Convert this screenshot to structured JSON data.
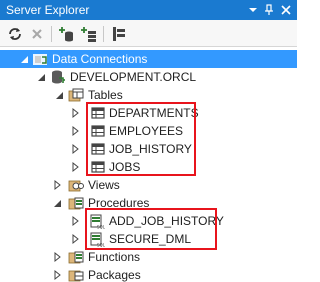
{
  "panel": {
    "title": "Server Explorer",
    "pin_glyph": "⊣",
    "close_glyph": "✕"
  },
  "toolbar": {
    "tools": [
      "refresh-icon",
      "stop-icon",
      "connect-to-database-icon",
      "connect-to-server-icon",
      "properties-icon"
    ]
  },
  "tree": {
    "data_connections": "Data Connections",
    "connection": "DEVELOPMENT.ORCL",
    "tables": "Tables",
    "table_items": [
      "DEPARTMENTS",
      "EMPLOYEES",
      "JOB_HISTORY",
      "JOBS"
    ],
    "views": "Views",
    "procedures": "Procedures",
    "procedure_items": [
      "ADD_JOB_HISTORY",
      "SECURE_DML"
    ],
    "functions": "Functions",
    "packages": "Packages"
  },
  "colors": {
    "title_bar": "#1a7ad0",
    "selection": "#3399ff",
    "highlight": "#e8141c"
  }
}
